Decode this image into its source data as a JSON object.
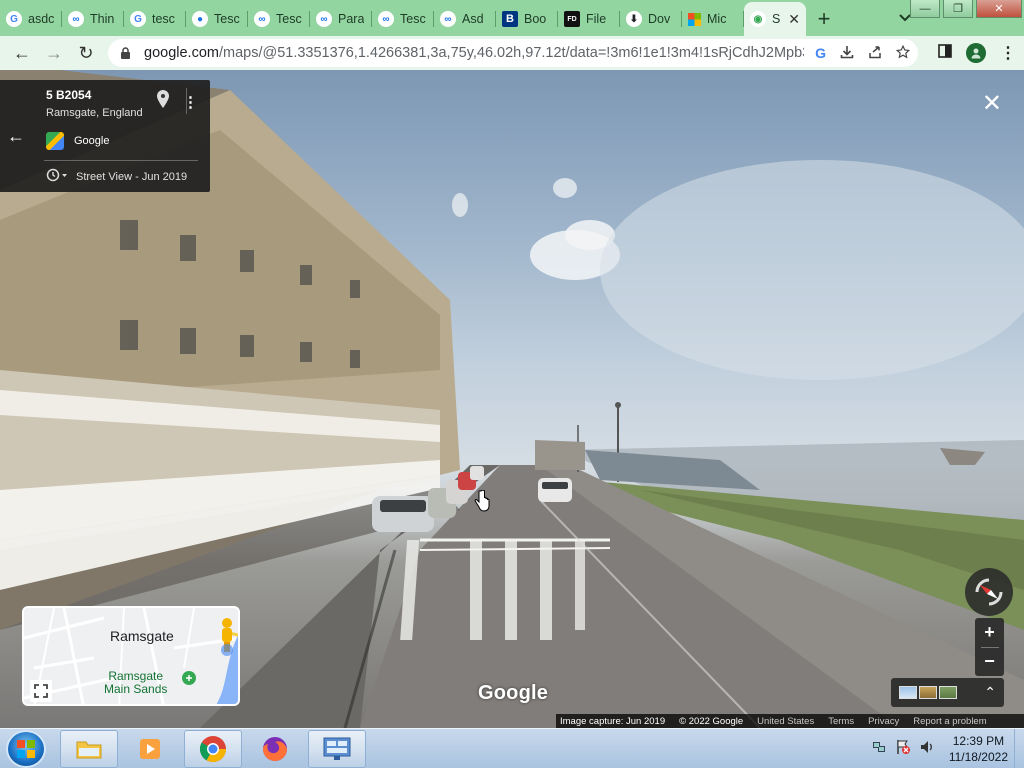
{
  "browser": {
    "tabs": [
      {
        "title": "asdc",
        "favicon": "google-g",
        "color": "#4285f4"
      },
      {
        "title": "Thin",
        "favicon": "eye-icon",
        "color": "#1a73e8"
      },
      {
        "title": "tesc",
        "favicon": "google-g",
        "color": "#4285f4"
      },
      {
        "title": "Tesc",
        "favicon": "dot-icon",
        "color": "#1a73e8"
      },
      {
        "title": "Tesc",
        "favicon": "eye-icon",
        "color": "#1a73e8"
      },
      {
        "title": "Para",
        "favicon": "eye-icon",
        "color": "#1a73e8"
      },
      {
        "title": "Tesc",
        "favicon": "eye-icon",
        "color": "#1a73e8"
      },
      {
        "title": "Asd",
        "favicon": "eye-icon",
        "color": "#1a73e8"
      },
      {
        "title": "Boo",
        "favicon": "b-icon",
        "color": "#003580"
      },
      {
        "title": "File",
        "favicon": "fd-icon",
        "color": "#111111"
      },
      {
        "title": "Dov",
        "favicon": "download-icon",
        "color": "#202124"
      },
      {
        "title": "Mic",
        "favicon": "microsoft-icon",
        "color": "#f25022"
      },
      {
        "title": "S",
        "favicon": "maps-pin-icon",
        "color": "#34a853",
        "active": true
      }
    ],
    "url_host": "google.com",
    "url_path": "/maps/@51.3351376,1.4266381,3a,75y,46.02h,97.12t/data=!3m6!1e1!3m4!1sRjCdhJ2Mpb3..."
  },
  "streetview": {
    "address_title": "5 B2054",
    "address_sub": "Ramsgate, England",
    "provider": "Google",
    "capture_label": "Street View - Jun 2019",
    "watermark": "Google",
    "minimap": {
      "town": "Ramsgate",
      "poi_line1": "Ramsgate",
      "poi_line2": "Main Sands"
    },
    "footer": {
      "capture": "Image capture: Jun 2019",
      "copyright": "© 2022 Google",
      "country": "United States",
      "terms": "Terms",
      "privacy": "Privacy",
      "report": "Report a problem"
    }
  },
  "taskbar": {
    "time": "12:39 PM",
    "date": "11/18/2022"
  }
}
